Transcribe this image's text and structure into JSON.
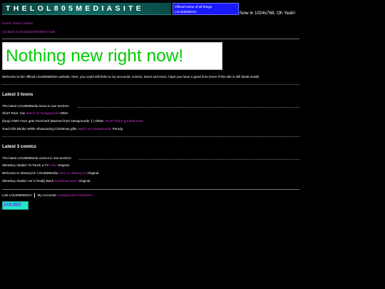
{
  "header": {
    "banner_text": "THELOL805MEDIASITE",
    "official_line1": "Official Home of all things",
    "official_line2": "LOL805MEDIA",
    "resolution_note": "Now in 1024x768, Oh Yeah!"
  },
  "nav": {
    "link1": "Home·Toons·Comics",
    "link2": "Go Back to Standard 800x600 mode"
  },
  "notice": {
    "text": "Nothing new right now!"
  },
  "welcome": {
    "text": "Welcome to the official LOL805MEDIA website, here, you could still links to my accounts, comics, toons and more, hope you have a good time (even if this site is still kinda small)"
  },
  "toons": {
    "title": "Latest 3 toons",
    "intro": "The latest LOL805Media toons in one section!",
    "items": [
      {
        "prefix": "Short Toon: Car",
        "link": "Watch on Newgrounds",
        "suffix": "Other"
      },
      {
        "prefix": "(loop) OMG Face gets Punched! (Banned from Newgrounds :( ) Other:",
        "link": "Proof That it got Blammed",
        "suffix": ""
      },
      {
        "prefix": "Toad Kills Bimbo While Showcasing Christmas gifts",
        "link": "Watch on Newgrounds!",
        "suffix": "Parody."
      }
    ]
  },
  "comics": {
    "title": "Latest 3 comics",
    "intro": "The latest LOL805Media comics in one section!",
    "items": [
      {
        "prefix": "Slimeboy Akakid: To Touch a TV",
        "link": "View",
        "suffix": "Original."
      },
      {
        "prefix": "Welcome to SheezyArt: LOL805Media",
        "link": "View on SheezyArt",
        "suffix": "Original."
      },
      {
        "prefix": "Slimeboy Akakid: He`s Finally Back",
        "link": "Download Here!",
        "suffix": "Original."
      }
    ]
  },
  "footer": {
    "link_label": "Link LOL805MEDIA!",
    "accounts_label": "My Accounts:",
    "accounts_links": "Newgrounds·DeviantArt"
  },
  "badge": {
    "text": "LOL805"
  }
}
